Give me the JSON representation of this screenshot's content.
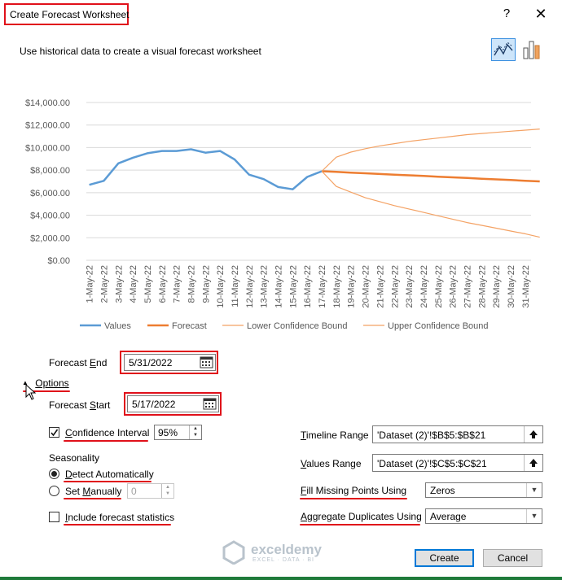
{
  "window": {
    "title": "Create Forecast Worksheet",
    "help": "?",
    "close": "✕"
  },
  "subtitle": "Use historical data to create a visual forecast worksheet",
  "colors": {
    "values": "#5b9bd5",
    "forecast": "#ed7d31",
    "accent": "#e0101a"
  },
  "chart_data": {
    "type": "line",
    "x": [
      "1-May-22",
      "2-May-22",
      "3-May-22",
      "4-May-22",
      "5-May-22",
      "6-May-22",
      "7-May-22",
      "8-May-22",
      "9-May-22",
      "10-May-22",
      "11-May-22",
      "12-May-22",
      "13-May-22",
      "14-May-22",
      "15-May-22",
      "16-May-22",
      "17-May-22",
      "18-May-22",
      "19-May-22",
      "20-May-22",
      "21-May-22",
      "22-May-22",
      "23-May-22",
      "24-May-22",
      "25-May-22",
      "26-May-22",
      "27-May-22",
      "28-May-22",
      "29-May-22",
      "30-May-22",
      "31-May-22"
    ],
    "yticks": [
      "$0.00",
      "$2,000.00",
      "$4,000.00",
      "$6,000.00",
      "$8,000.00",
      "$10,000.00",
      "$12,000.00",
      "$14,000.00"
    ],
    "ylim": [
      0,
      14000
    ],
    "grid": true,
    "legend_position": "bottom",
    "series": [
      {
        "name": "Values",
        "color": "#5b9bd5",
        "start": 0,
        "values": [
          6700,
          7050,
          8600,
          9100,
          9500,
          9700,
          9700,
          9850,
          9550,
          9700,
          8950,
          7600,
          7200,
          6500,
          6300,
          7400,
          7900
        ]
      },
      {
        "name": "Forecast",
        "color": "#ed7d31",
        "start": 16,
        "values": [
          7900,
          7850,
          7780,
          7720,
          7660,
          7600,
          7540,
          7480,
          7420,
          7360,
          7300,
          7240,
          7180,
          7120,
          7060,
          7000
        ]
      },
      {
        "name": "Lower Confidence Bound",
        "color": "#f4a264",
        "start": 16,
        "values": [
          7900,
          6550,
          6050,
          5550,
          5200,
          4850,
          4550,
          4250,
          3950,
          3650,
          3350,
          3100,
          2850,
          2600,
          2350,
          2050
        ]
      },
      {
        "name": "Upper Confidence Bound",
        "color": "#f4a264",
        "start": 16,
        "values": [
          7900,
          9150,
          9600,
          9900,
          10150,
          10350,
          10550,
          10700,
          10850,
          11000,
          11150,
          11250,
          11350,
          11450,
          11550,
          11650
        ]
      }
    ]
  },
  "forecast_end": {
    "label_pre": "Forecast ",
    "label_key": "E",
    "label_post": "nd",
    "value": "5/31/2022"
  },
  "options_toggle": {
    "arrow": "▲",
    "label": "Options"
  },
  "forecast_start": {
    "label_pre": "Forecast ",
    "label_key": "S",
    "label_post": "tart",
    "value": "5/17/2022"
  },
  "confidence": {
    "label_key": "C",
    "label_post": "onfidence Interval",
    "value": "95%",
    "checked": true
  },
  "seasonality": {
    "heading": "Seasonality",
    "auto": {
      "label_key": "D",
      "label_post": "etect Automatically",
      "selected": true
    },
    "manual": {
      "label_pre": "Set ",
      "label_key": "M",
      "label_post": "anually",
      "value": "0",
      "selected": false
    }
  },
  "include_stats": {
    "label_key": "I",
    "label_post": "nclude forecast statistics",
    "checked": false
  },
  "timeline_range": {
    "label_key": "T",
    "label_post": "imeline Range",
    "value": "'Dataset (2)'!$B$5:$B$21"
  },
  "values_range": {
    "label_key": "V",
    "label_post": "alues Range",
    "value": "'Dataset (2)'!$C$5:$C$21"
  },
  "fill_missing": {
    "label_key": "F",
    "label_post": "ill Missing Points Using",
    "value": "Zeros"
  },
  "aggregate": {
    "label_key": "A",
    "label_post": "ggregate Duplicates Using",
    "value": "Average"
  },
  "buttons": {
    "create": "Create",
    "cancel": "Cancel"
  },
  "watermark": {
    "name": "exceldemy",
    "tagline": "EXCEL · DATA · BI"
  }
}
